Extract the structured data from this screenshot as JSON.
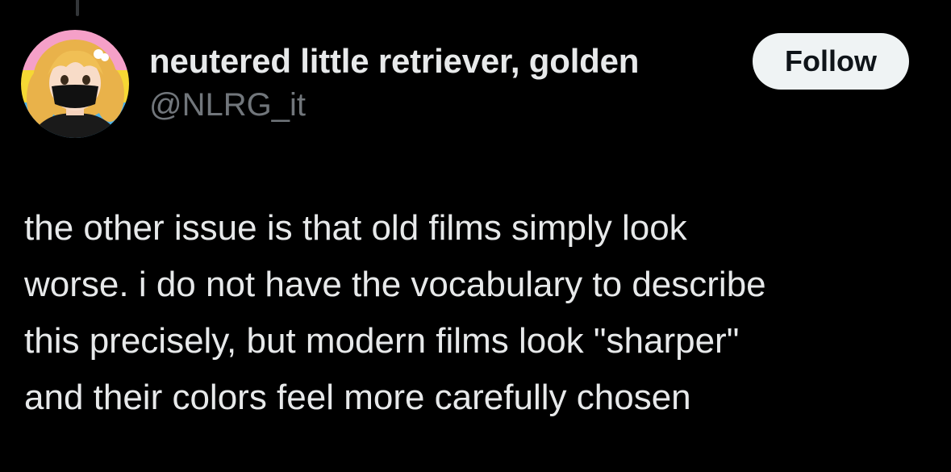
{
  "author": {
    "display_name": "neutered little retriever, golden",
    "handle": "@NLRG_it"
  },
  "actions": {
    "follow_label": "Follow"
  },
  "tweet": {
    "lines": [
      "the other issue is that old films simply look",
      "worse. i do not have the vocabulary to describe",
      "this precisely, but modern films look \"sharper\"",
      "and their colors feel more carefully chosen"
    ]
  },
  "colors": {
    "background": "#000000",
    "primary_text": "#e7e9ea",
    "secondary_text": "#71767b",
    "follow_button_bg": "#eff3f4",
    "follow_button_text": "#0f1419"
  }
}
